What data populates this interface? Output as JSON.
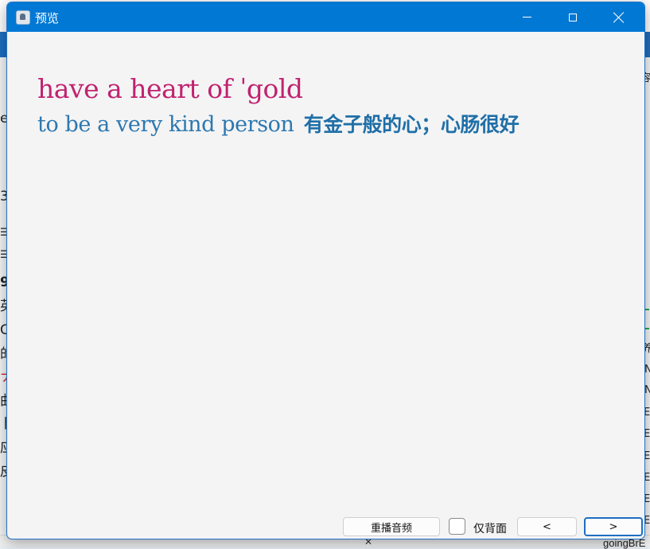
{
  "window": {
    "title": "预览"
  },
  "card": {
    "phrase": "have a heart of ˈgold",
    "definition": "to be a very kind person",
    "translation": "有金子般的心；心肠很好"
  },
  "controls": {
    "replay_label": "重播音频",
    "back_only_label": "仅背面",
    "back_only_checked": false,
    "prev_label": "<",
    "next_label": ">"
  },
  "background_app": {
    "left_fragments": [
      "e",
      "3",
      "☰",
      "☰",
      "9",
      "英",
      "C",
      "的",
      "ナ",
      "曲",
      "卜",
      "应",
      "皮"
    ],
    "right_fragments": [
      "容",
      "养",
      "N",
      "N",
      "E",
      "E",
      "E",
      "E",
      "E",
      "E",
      "E"
    ],
    "bottom_text": "goingBrE",
    "colors": {
      "accent": "#0078d4",
      "phrase": "#c0236f",
      "definition": "#2d78b0"
    }
  }
}
